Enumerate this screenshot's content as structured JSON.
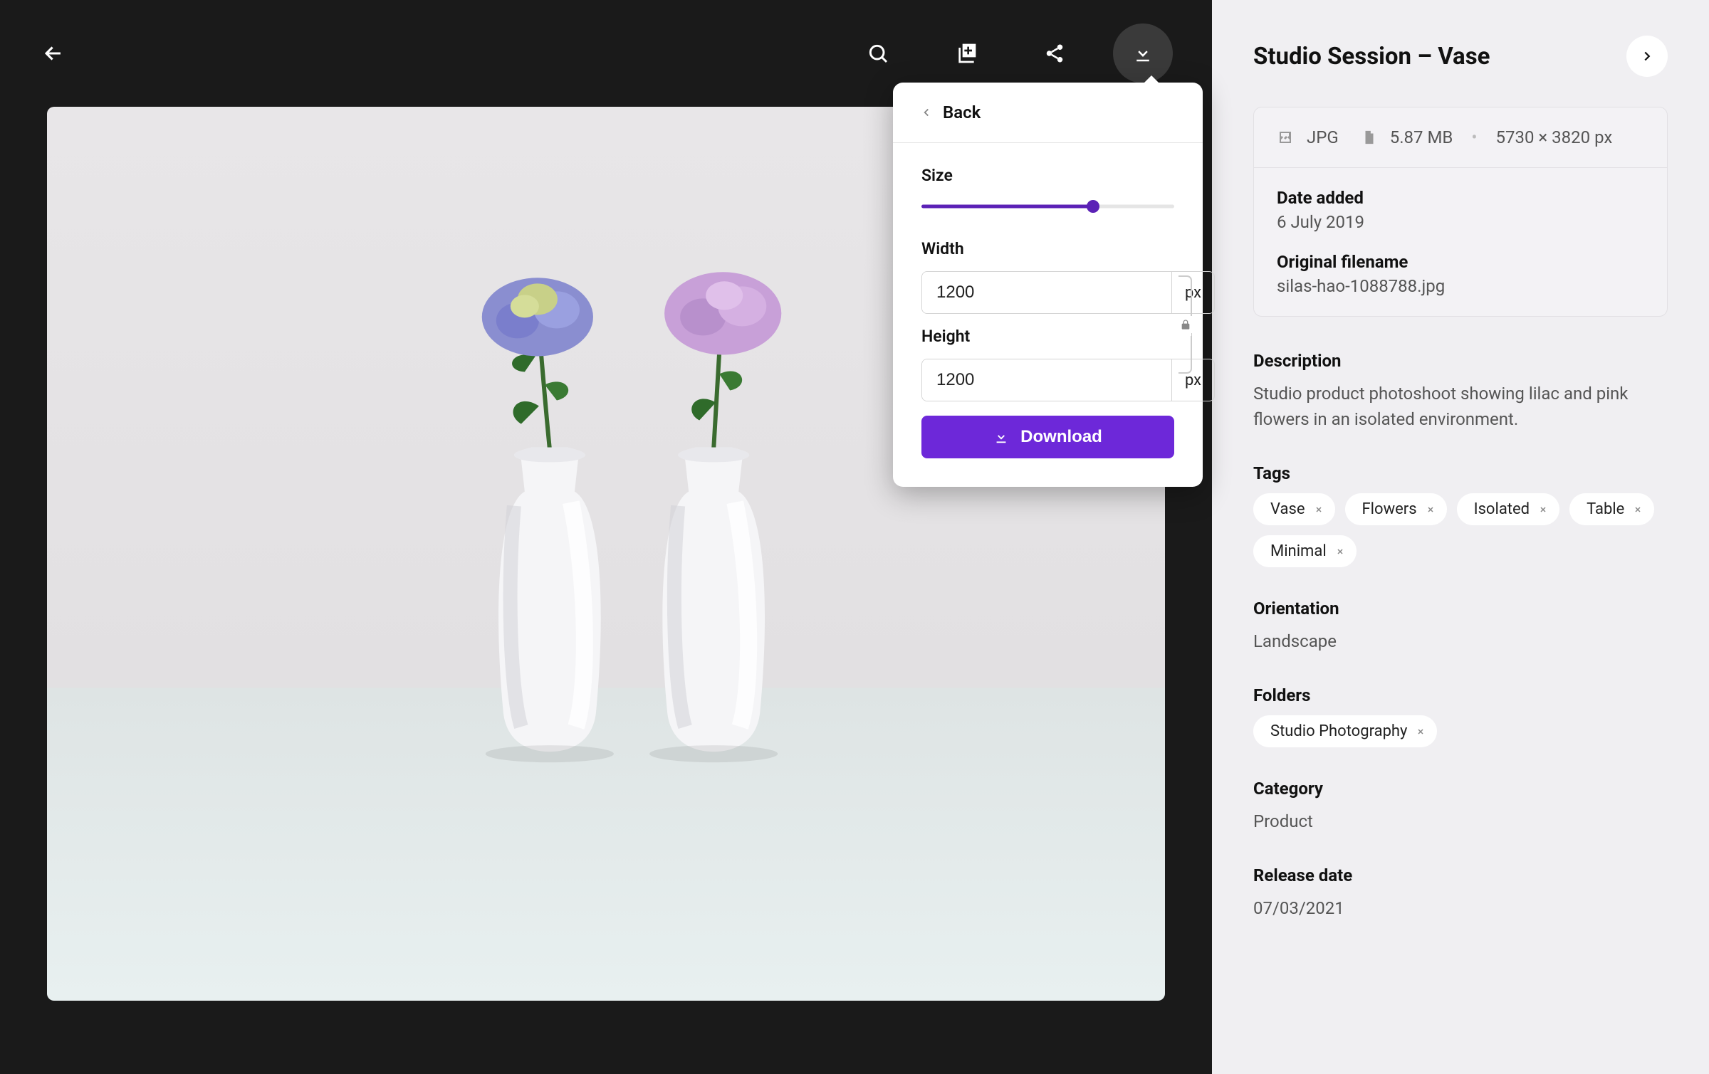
{
  "toolbar": {
    "download_active": true
  },
  "popover": {
    "back_label": "Back",
    "size_label": "Size",
    "width_label": "Width",
    "height_label": "Height",
    "width_value": "1200",
    "height_value": "1200",
    "unit": "px",
    "slider_percent": 68,
    "download_button": "Download"
  },
  "sidebar": {
    "title": "Studio Session – Vase",
    "meta": {
      "format": "JPG",
      "size": "5.87 MB",
      "dimensions": "5730 × 3820 px",
      "date_added_label": "Date added",
      "date_added": "6 July 2019",
      "filename_label": "Original filename",
      "filename": "silas-hao-1088788.jpg"
    },
    "description_label": "Description",
    "description": "Studio product photoshoot showing lilac and pink flowers in an isolated environment.",
    "tags_label": "Tags",
    "tags": [
      "Vase",
      "Flowers",
      "Isolated",
      "Table",
      "Minimal"
    ],
    "orientation_label": "Orientation",
    "orientation": "Landscape",
    "folders_label": "Folders",
    "folders": [
      "Studio Photography"
    ],
    "category_label": "Category",
    "category": "Product",
    "release_label": "Release date",
    "release": "07/03/2021"
  }
}
